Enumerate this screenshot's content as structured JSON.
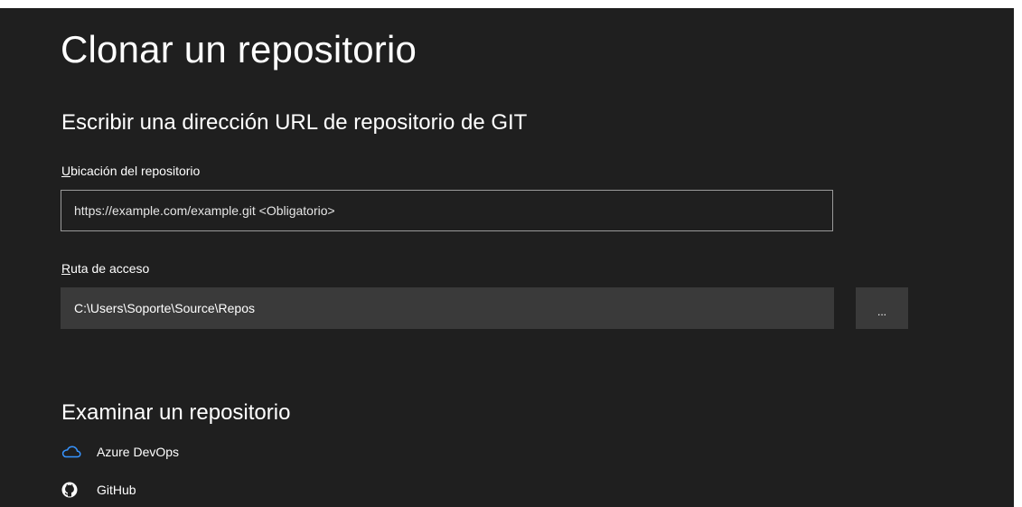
{
  "page": {
    "title": "Clonar un repositorio"
  },
  "url_section": {
    "heading": "Escribir una dirección URL de repositorio de GIT",
    "location_label_key": "U",
    "location_label_rest": "bicación del repositorio",
    "location_value": "",
    "location_placeholder": "https://example.com/example.git <Obligatorio>",
    "path_label_key": "R",
    "path_label_rest": "uta de acceso",
    "path_value": "C:\\Users\\Soporte\\Source\\Repos",
    "browse_label": "..."
  },
  "browse_section": {
    "heading": "Examinar un repositorio",
    "providers": [
      {
        "label": "Azure DevOps",
        "icon": "cloud-icon"
      },
      {
        "label": "GitHub",
        "icon": "github-icon"
      }
    ]
  },
  "colors": {
    "background": "#1f1f1f",
    "input_fill": "#3a3a3a",
    "input_border": "#9a9a9a",
    "azure_accent": "#3794ff",
    "text": "#ffffff"
  }
}
